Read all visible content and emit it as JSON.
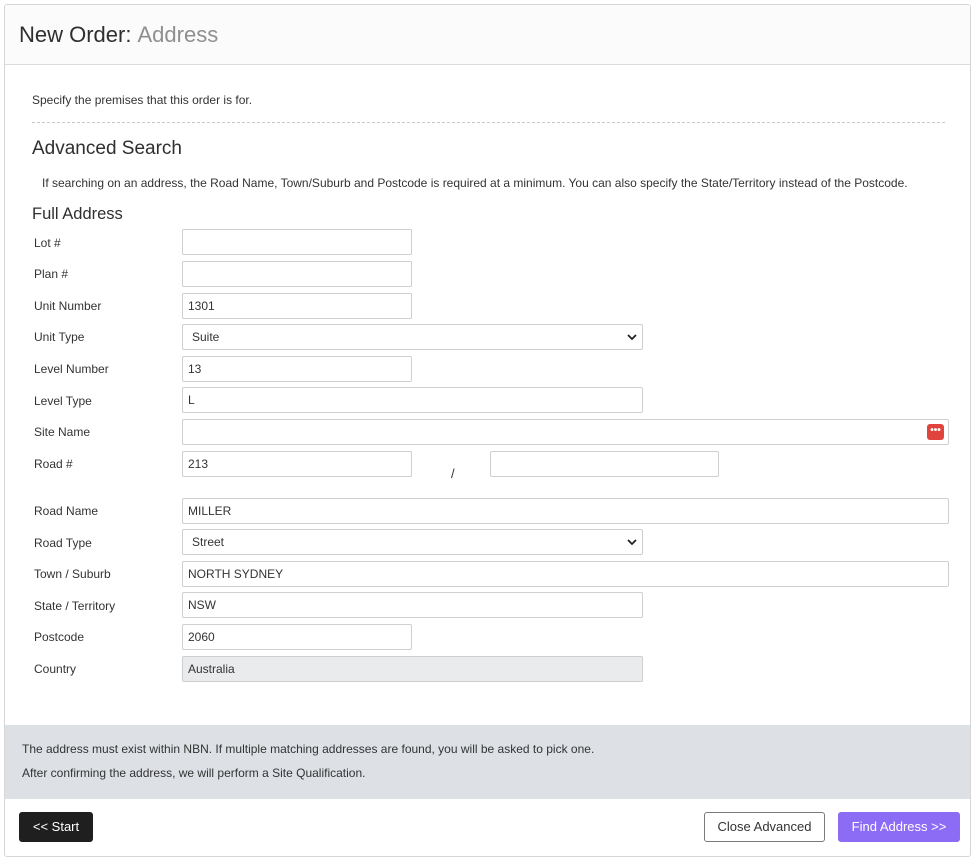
{
  "header": {
    "title": "New Order:",
    "subtitle": "Address"
  },
  "intro": "Specify the premises that this order is for.",
  "advanced": {
    "title": "Advanced Search",
    "description": "If searching on an address, the Road Name, Town/Suburb and Postcode is required at a minimum. You can also specify the State/Territory instead of the Postcode."
  },
  "full_address": {
    "title": "Full Address",
    "fields": {
      "lot": {
        "label": "Lot #",
        "value": ""
      },
      "plan": {
        "label": "Plan #",
        "value": ""
      },
      "unit_number": {
        "label": "Unit Number",
        "value": "1301"
      },
      "unit_type": {
        "label": "Unit Type",
        "value": "Suite"
      },
      "level_number": {
        "label": "Level Number",
        "value": "13"
      },
      "level_type": {
        "label": "Level Type",
        "value": "L"
      },
      "site_name": {
        "label": "Site Name",
        "value": "",
        "button_icon": "ellipsis-icon",
        "button_glyph": "•••",
        "button_color": "#e0443c"
      },
      "road_number": {
        "label": "Road #",
        "value": "213",
        "separator": "/",
        "value_to": ""
      },
      "road_name": {
        "label": "Road Name",
        "value": "MILLER"
      },
      "road_type": {
        "label": "Road Type",
        "value": "Street"
      },
      "town_suburb": {
        "label": "Town / Suburb",
        "value": "NORTH SYDNEY"
      },
      "state_territory": {
        "label": "State / Territory",
        "value": "NSW"
      },
      "postcode": {
        "label": "Postcode",
        "value": "2060"
      },
      "country": {
        "label": "Country",
        "value": "Australia"
      }
    }
  },
  "footer_note": {
    "line1": "The address must exist within NBN. If multiple matching addresses are found, you will be asked to pick one.",
    "line2": "After confirming the address, we will perform a Site Qualification."
  },
  "buttons": {
    "start": "<< Start",
    "close_advanced": "Close Advanced",
    "find_address": "Find Address >>"
  },
  "colors": {
    "primary_button": "#8c6cf5",
    "start_button": "#1f1f1f",
    "note_background": "#dde0e4"
  }
}
